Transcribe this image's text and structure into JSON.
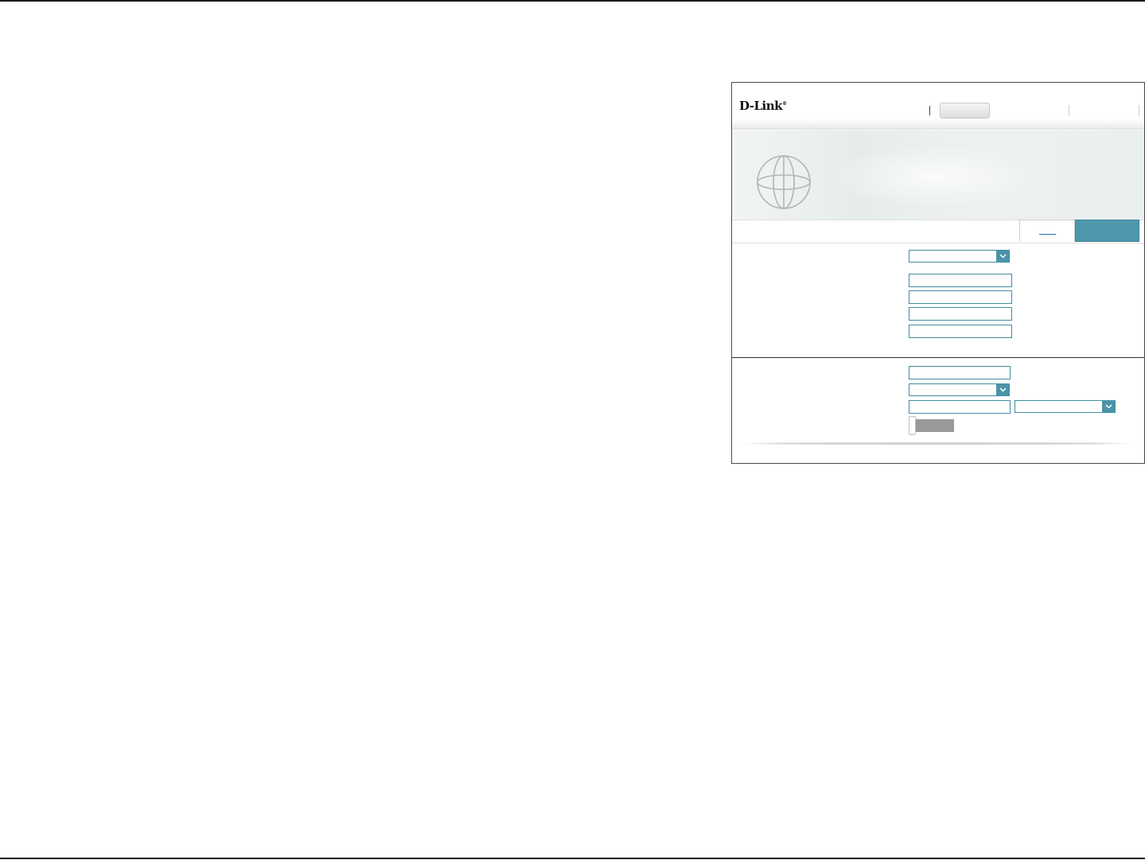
{
  "header": {
    "logo": "D-Link",
    "logo_mark": "®"
  },
  "icons": {
    "globe": "globe-icon",
    "dropdown": "chevron-down-icon"
  },
  "colors": {
    "accent": "#4e98ad",
    "field_border": "#3f8ea3",
    "toggle_off": "#999999"
  },
  "settings": {
    "toggle_on": false
  }
}
